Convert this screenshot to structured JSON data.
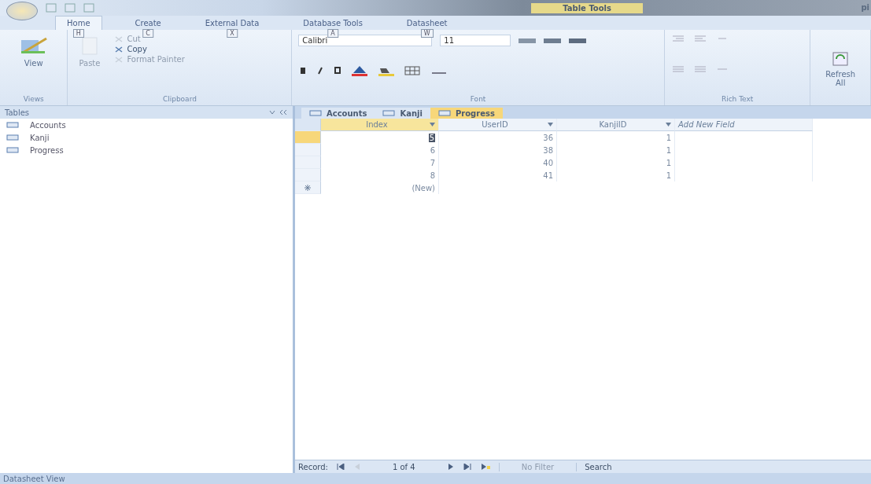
{
  "title_bar": {
    "contextual_label": "Table Tools",
    "title": "pi"
  },
  "ribbon_tabs": [
    {
      "label": "Home",
      "keytip": "H",
      "selected": true
    },
    {
      "label": "Create",
      "keytip": "C",
      "selected": false
    },
    {
      "label": "External Data",
      "keytip": "X",
      "selected": false
    },
    {
      "label": "Database Tools",
      "keytip": "A",
      "selected": false
    },
    {
      "label": "Datasheet",
      "keytip": "W",
      "selected": false
    }
  ],
  "ribbon": {
    "views": {
      "label": "Views",
      "view_button": "View"
    },
    "clipboard": {
      "label": "Clipboard",
      "paste": {
        "label": "Paste",
        "disabled": true
      },
      "buttons": [
        {
          "label": "Cut",
          "disabled": true
        },
        {
          "label": "Copy",
          "disabled": false
        },
        {
          "label": "Format Painter",
          "disabled": true
        }
      ]
    },
    "font": {
      "label": "Font",
      "font_name": "Calibri",
      "font_size": "11"
    },
    "rich_text": {
      "label": "Rich Text"
    },
    "refresh": {
      "label": "Refresh All"
    }
  },
  "nav_pane": {
    "title": "Tables",
    "items": [
      "Accounts",
      "Kanji",
      "Progress"
    ]
  },
  "document_tabs": [
    {
      "label": "Accounts",
      "selected": false
    },
    {
      "label": "Kanji",
      "selected": false
    },
    {
      "label": "Progress",
      "selected": true
    }
  ],
  "table": {
    "columns": [
      "Index",
      "UserID",
      "KanjiID"
    ],
    "add_field": "Add New Field",
    "rows": [
      {
        "cells": [
          "5",
          "36",
          "1"
        ],
        "selected": true
      },
      {
        "cells": [
          "6",
          "38",
          "1"
        ],
        "selected": false
      },
      {
        "cells": [
          "7",
          "40",
          "1"
        ],
        "selected": false
      },
      {
        "cells": [
          "8",
          "41",
          "1"
        ],
        "selected": false
      }
    ],
    "new_row": "(New)"
  },
  "record_nav": {
    "label": "Record:",
    "position": "1 of 4",
    "filter": "No Filter",
    "search": "Search"
  },
  "status_bar": "Datasheet View"
}
